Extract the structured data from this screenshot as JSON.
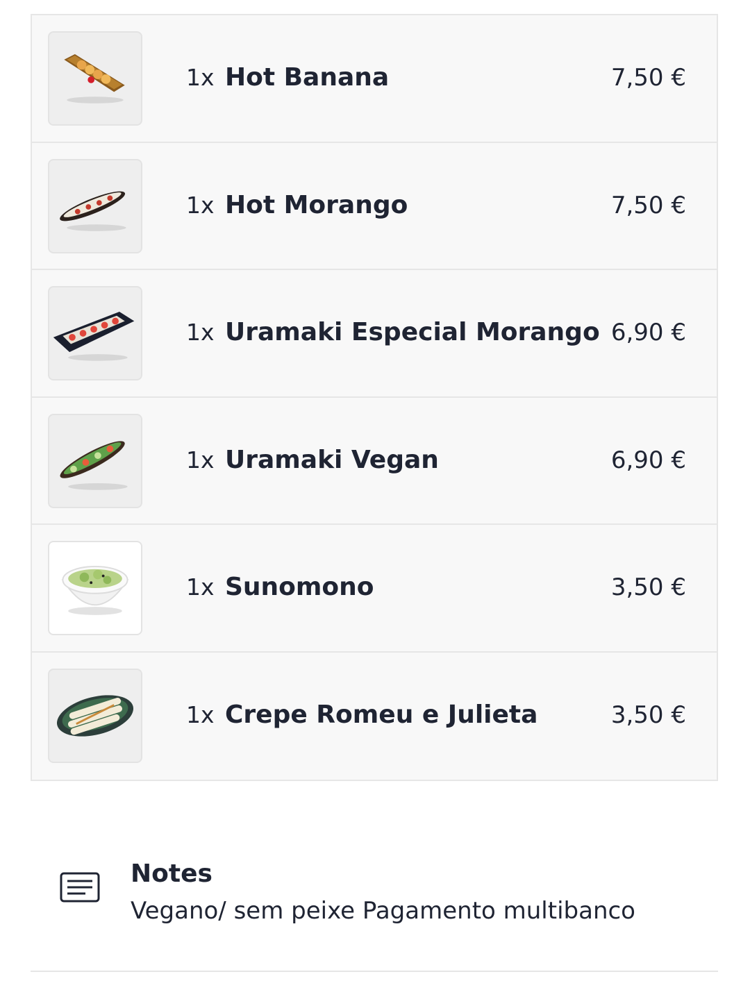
{
  "order": {
    "items": [
      {
        "qty": "1x",
        "name": "Hot Banana",
        "price": "7,50 €",
        "image_icon": "sushi-board-icon"
      },
      {
        "qty": "1x",
        "name": "Hot Morango",
        "price": "7,50 €",
        "image_icon": "sushi-roll-plate-icon"
      },
      {
        "qty": "1x",
        "name": "Uramaki Especial Morango",
        "price": "6,90 €",
        "image_icon": "uramaki-plate-icon"
      },
      {
        "qty": "1x",
        "name": "Uramaki Vegan",
        "price": "6,90 €",
        "image_icon": "vegan-roll-plate-icon"
      },
      {
        "qty": "1x",
        "name": "Sunomono",
        "price": "3,50 €",
        "image_icon": "salad-bowl-icon"
      },
      {
        "qty": "1x",
        "name": "Crepe Romeu e Julieta",
        "price": "3,50 €",
        "image_icon": "crepe-plate-icon"
      }
    ]
  },
  "notes": {
    "title": "Notes",
    "text": "Vegano/ sem peixe Pagamento multibanco",
    "icon": "notes-icon"
  },
  "colors": {
    "text": "#1f2433",
    "row_background": "#f8f8f8",
    "border": "#e6e6e6"
  }
}
